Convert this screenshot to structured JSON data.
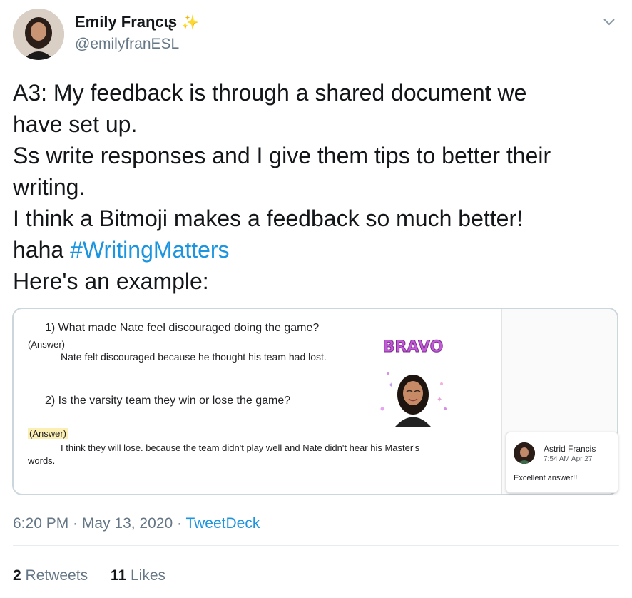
{
  "author": {
    "name": "Emily Fraɳcɩʂ",
    "handle": "@emilyfranESL",
    "badge": "star-icon"
  },
  "tweet": {
    "lines": [
      "A3: My feedback is through a shared document we",
      "have set up.",
      "Ss write responses and I give them tips to better their",
      "writing.",
      "I think a Bitmoji makes a feedback so much better!"
    ],
    "last_line_prefix": "haha ",
    "hashtag": "#WritingMatters",
    "closing": "Here's an example:"
  },
  "media": {
    "q1": "1) What made Nate feel discouraged doing the game?",
    "q1_label": "(Answer)",
    "q1_answer": "Nate felt discouraged because he thought his team had lost.",
    "q2": "2) Is the varsity team they win or lose the game?",
    "q2_label": "(Answer)",
    "q2_answer_line1": "I think they will lose. because the team didn't play well and Nate didn't hear his Master's",
    "q2_answer_line2": "words.",
    "sticker_text": "BRAVO",
    "comment": {
      "name": "Astrid Francis",
      "time": "7:54 AM Apr 27",
      "text": "Excellent answer!!"
    }
  },
  "meta": {
    "time": "6:20 PM",
    "sep1": " · ",
    "date": "May 13, 2020",
    "sep2": " · ",
    "source": "TweetDeck"
  },
  "stats": {
    "retweets_count": "2",
    "retweets_label": "Retweets",
    "likes_count": "11",
    "likes_label": "Likes"
  },
  "colors": {
    "link": "#1b95e0",
    "muted": "#657786",
    "text": "#14171a"
  }
}
